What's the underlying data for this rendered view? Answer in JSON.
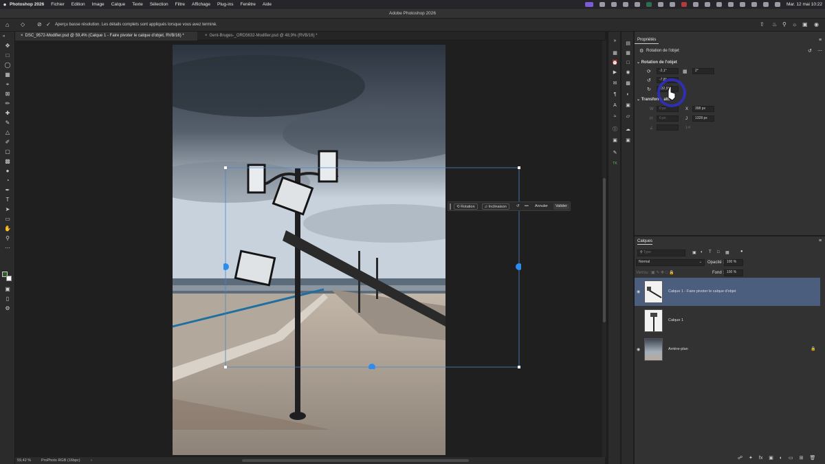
{
  "menubar": {
    "apple": "",
    "app_name": "Photoshop 2026",
    "items": [
      "Fichier",
      "Edition",
      "Image",
      "Calque",
      "Texte",
      "Sélection",
      "Filtre",
      "Affichage",
      "Plug-ins",
      "Fenêtre",
      "Aide"
    ],
    "clock": "Mar. 12 mai  10:22"
  },
  "window": {
    "title": "Adobe Photoshop 2026"
  },
  "options_bar": {
    "message": "Aperçu basse résolution. Les détails complets sont appliqués lorsque vous avez terminé."
  },
  "tabs": [
    {
      "label": "DSC_9572-Modifier.psd @ 59,4% (Calque 1 - Faire pivoter le calque d'objet, RVB/16) *"
    },
    {
      "label": "Gent-Bruges-_ORD5632-Modifier.psd @ 48,9% (RVB/16) *"
    }
  ],
  "status_bar": {
    "zoom": "59,42 %",
    "profile": "ProPhoto RGB (16bpc)",
    "arrow": "›"
  },
  "context_bar": {
    "rotation": "Rotation",
    "inclinaison": "Inclinaison",
    "more": "•••",
    "annuler": "Annuler",
    "valider": "Valider"
  },
  "properties": {
    "tab": "Propriétés",
    "object_label": "Rotation de l'objet",
    "section_rotation": "Rotation de l'objet",
    "rot_field_1": "-2,1°",
    "rot_field_2": "2°",
    "rot_field_3": "-7,8°",
    "rot_field_4": "132,9°",
    "section_transform": "Transform. att.",
    "x_label": "X",
    "x_value": "398 px",
    "y_label": "J",
    "y_value": "1328 px",
    "w_value": "0 px",
    "h_value": "0 px"
  },
  "layers": {
    "title": "Calques",
    "search_placeholder": "Type",
    "blend_mode": "Normal",
    "opacity_label": "Opacité :",
    "opacity_value": "100 %",
    "lock_label": "Verrou :",
    "fill_label": "Fond :",
    "fill_value": "100 %",
    "items": [
      {
        "name": "Calque 1 - Faire pivoter le calque d'objet",
        "selected": true
      },
      {
        "name": "Calque 1",
        "selected": false
      },
      {
        "name": "Arrière-plan",
        "selected": false
      }
    ]
  },
  "colors": {
    "selected_layer": "#4b5e7d",
    "accent_blue": "#2d8cf0",
    "cursor_ring": "#2f2fbf"
  }
}
